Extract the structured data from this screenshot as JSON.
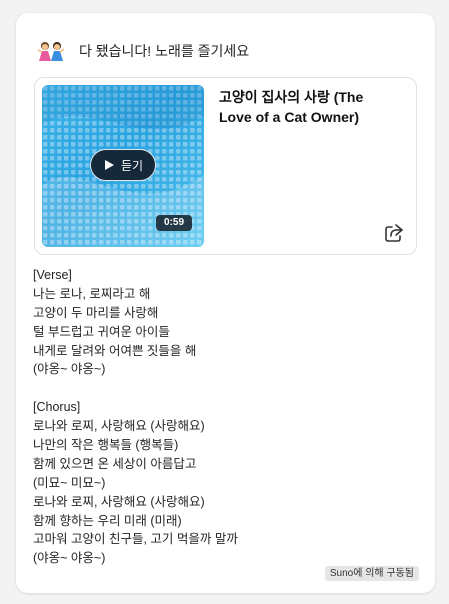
{
  "header": {
    "message": "다 됐습니다! 노래를 즐기세요",
    "icon": "dancing-people-icon"
  },
  "song": {
    "title": "고양이 집사의 사랑 (The Love of a Cat Owner)",
    "play_label": "듣기",
    "duration": "0:59",
    "cover_color": "#2aa3e0"
  },
  "lyrics": [
    "[Verse]",
    "나는 로나, 로찌라고 해",
    "고양이 두 마리를 사랑해",
    "털 부드럽고 귀여운 아이들",
    "내게로 달려와 어여쁜 짓들을 해",
    "(야옹~ 야옹~)",
    "",
    "[Chorus]",
    "로나와 로찌, 사랑해요 (사랑해요)",
    "나만의 작은 행복들 (행복들)",
    "함께 있으면 온 세상이 아름답고",
    "(미묘~ 미묘~)",
    "로나와 로찌, 사랑해요 (사랑해요)",
    "함께 향하는 우리 미래 (미래)",
    "고마워 고양이 친구들, 고기 먹을까 말까",
    "(야옹~ 야옹~)"
  ],
  "footer": {
    "powered_by": "Suno에 의해 구동됨"
  }
}
